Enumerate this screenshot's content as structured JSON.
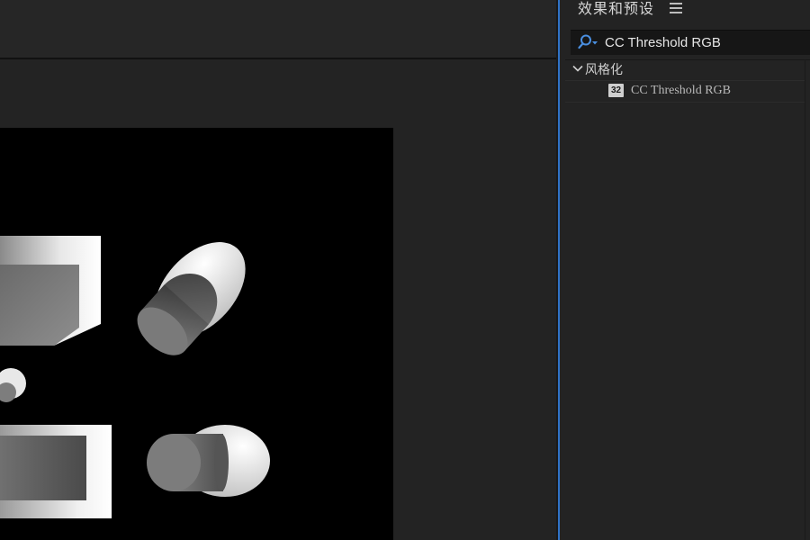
{
  "effects_panel": {
    "title": "效果和预设",
    "menu_icon": "hamburger-menu-icon",
    "search": {
      "value": "CC Threshold RGB",
      "search_icon": "search-dropdown-icon",
      "clear_icon": "close-icon",
      "clear_label": "×"
    },
    "tree": {
      "category": {
        "label": "风格化",
        "expanded": true,
        "icon": "chevron-down-icon"
      },
      "items": [
        {
          "badge": "32",
          "label": "CC Threshold RGB",
          "icon": "32-bit-effect-icon"
        }
      ]
    }
  },
  "colors": {
    "background": "#232323",
    "composition": "#000000",
    "accent_focus": "#2f73c7",
    "search_icon": "#4a8fe0"
  }
}
